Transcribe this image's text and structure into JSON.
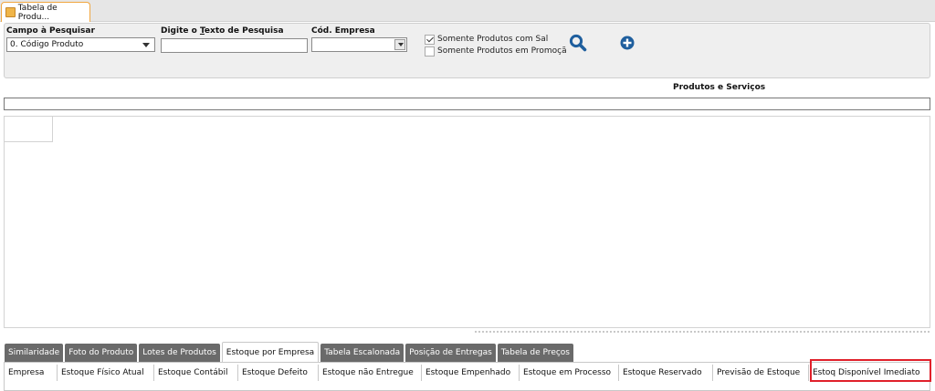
{
  "window": {
    "tab_title": "Tabela de Produ..."
  },
  "search": {
    "campo_label": "Campo à Pesquisar",
    "campo_value": "0. Código Produto",
    "texto_label_pre": "Digite o ",
    "texto_label_underlined": "T",
    "texto_label_post": "exto de Pesquisa",
    "texto_value": "",
    "empresa_label": "Cód. Empresa",
    "empresa_value": "",
    "chk_saldo_label": "Somente Produtos com Sal",
    "chk_saldo_checked": true,
    "chk_promo_label": "Somente Produtos em Promoçã",
    "chk_promo_checked": false,
    "search_icon": "search-icon",
    "add_icon": "plus-circle-icon"
  },
  "section": {
    "title": "Produtos e Serviços"
  },
  "bottom_tabs": [
    {
      "label": "Similaridade",
      "active": false
    },
    {
      "label": "Foto do Produto",
      "active": false
    },
    {
      "label": "Lotes de Produtos",
      "active": false
    },
    {
      "label": "Estoque por Empresa",
      "active": true
    },
    {
      "label": "Tabela Escalonada",
      "active": false
    },
    {
      "label": "Posição de Entregas",
      "active": false
    },
    {
      "label": "Tabela de Preços",
      "active": false
    }
  ],
  "stock_columns": [
    "Empresa",
    "Estoque Físico Atual",
    "Estoque Contábil",
    "Estoque Defeito",
    "Estoque não Entregue",
    "Estoque Empenhado",
    "Estoque em Processo",
    "Estoque Reservado",
    "Previsão de Estoque",
    "Estoq Disponível Imediato"
  ],
  "colors": {
    "accent_orange": "#f0a640",
    "tab_dark": "#6a6a6a",
    "icon_blue": "#1f5f9e",
    "highlight_red": "#e0202a"
  }
}
